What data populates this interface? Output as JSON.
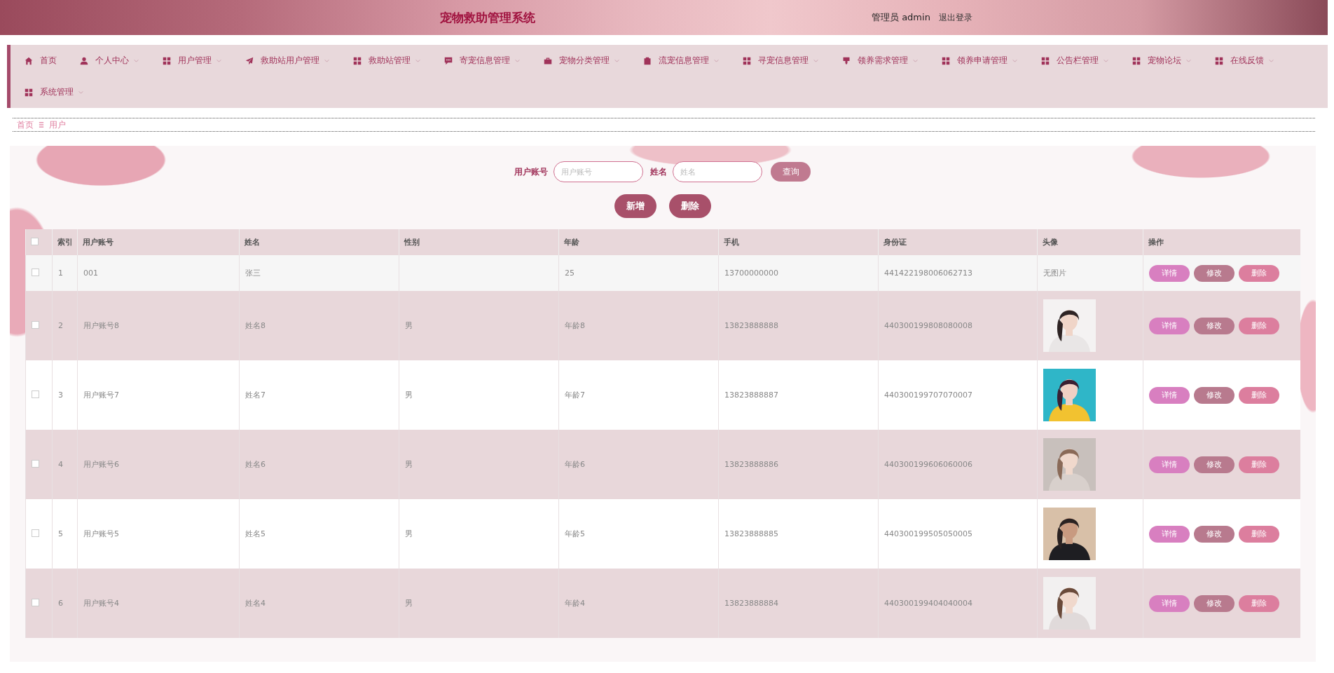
{
  "header": {
    "title": "宠物救助管理系统",
    "user": "管理员 admin",
    "logout": "退出登录"
  },
  "nav": {
    "items": [
      {
        "label": "首页",
        "dropdown": false
      },
      {
        "label": "个人中心",
        "dropdown": true
      },
      {
        "label": "用户管理",
        "dropdown": true
      },
      {
        "label": "救助站用户管理",
        "dropdown": true
      },
      {
        "label": "救助站管理",
        "dropdown": true
      },
      {
        "label": "寄宠信息管理",
        "dropdown": true
      },
      {
        "label": "宠物分类管理",
        "dropdown": true
      },
      {
        "label": "流宠信息管理",
        "dropdown": true
      },
      {
        "label": "寻宠信息管理",
        "dropdown": true
      },
      {
        "label": "领养需求管理",
        "dropdown": true
      },
      {
        "label": "领养申请管理",
        "dropdown": true
      },
      {
        "label": "公告栏管理",
        "dropdown": true
      },
      {
        "label": "宠物论坛",
        "dropdown": true
      },
      {
        "label": "在线反馈",
        "dropdown": true
      },
      {
        "label": "系统管理",
        "dropdown": true
      }
    ]
  },
  "breadcrumb": [
    "首页",
    "用户"
  ],
  "search": {
    "fields": [
      {
        "label": "用户账号",
        "placeholder": "用户账号"
      },
      {
        "label": "姓名",
        "placeholder": "姓名"
      }
    ],
    "button": "查询"
  },
  "actions": [
    "新增",
    "删除"
  ],
  "table": {
    "select_all": {
      "checked": false
    },
    "columns": [
      "索引",
      "用户账号",
      "姓名",
      "性别",
      "年龄",
      "手机",
      "身份证",
      "头像",
      "操作"
    ],
    "rows": [
      {
        "checked": false,
        "cells": [
          "1",
          "001",
          "张三",
          "",
          "25",
          "13700000000",
          "441422198006062713"
        ],
        "avatar": {
          "kind": "text",
          "text": "无图片"
        },
        "buttons": [
          "详情",
          "修改",
          "删除"
        ]
      },
      {
        "checked": false,
        "cells": [
          "2",
          "用户账号8",
          "姓名8",
          "男",
          "年龄8",
          "13823888888",
          "440300199808080008"
        ],
        "buttons": [
          "详情",
          "修改",
          "删除"
        ]
      },
      {
        "checked": false,
        "cells": [
          "3",
          "用户账号7",
          "姓名7",
          "男",
          "年龄7",
          "13823888887",
          "440300199707070007"
        ],
        "buttons": [
          "详情",
          "修改",
          "删除"
        ]
      },
      {
        "checked": false,
        "cells": [
          "4",
          "用户账号6",
          "姓名6",
          "男",
          "年龄6",
          "13823888886",
          "440300199606060006"
        ],
        "buttons": [
          "详情",
          "修改",
          "删除"
        ]
      },
      {
        "checked": false,
        "cells": [
          "5",
          "用户账号5",
          "姓名5",
          "男",
          "年龄5",
          "13823888885",
          "440300199505050005"
        ],
        "buttons": [
          "详情",
          "修改",
          "删除"
        ]
      },
      {
        "checked": false,
        "cells": [
          "6",
          "用户账号4",
          "姓名4",
          "男",
          "年龄4",
          "13823888884",
          "440300199404040004"
        ],
        "buttons": [
          "详情",
          "修改",
          "删除"
        ]
      }
    ]
  }
}
